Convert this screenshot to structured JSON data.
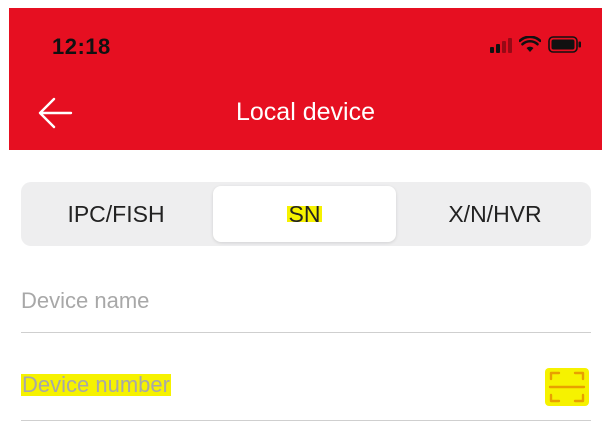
{
  "status_bar": {
    "time": "12:18",
    "icons": [
      "cellular-signal-icon",
      "wifi-icon",
      "battery-icon"
    ]
  },
  "header": {
    "title": "Local device",
    "back_icon": "arrow-left-icon",
    "background_color": "#e60f21"
  },
  "tabs": [
    {
      "label": "IPC/FISH",
      "selected": false
    },
    {
      "label": "SN",
      "selected": true
    },
    {
      "label": "X/N/HVR",
      "selected": false
    }
  ],
  "form": {
    "device_name": {
      "placeholder": "Device name",
      "value": ""
    },
    "device_number": {
      "placeholder": "Device number",
      "value": "",
      "action_icon": "scan-icon"
    }
  },
  "highlight_color": "#f6f200"
}
